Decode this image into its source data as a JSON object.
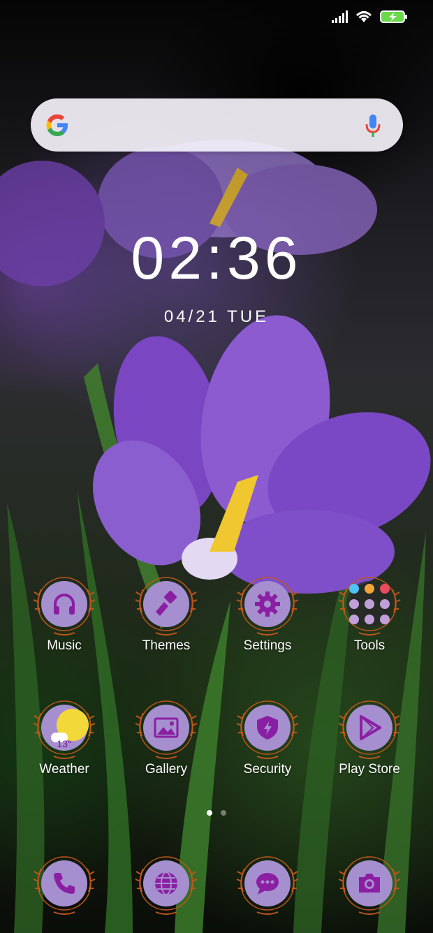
{
  "clock": {
    "time": "02:36",
    "date": "04/21 TUE"
  },
  "search": {
    "placeholder": ""
  },
  "apps": {
    "row1": [
      {
        "label": "Music",
        "icon": "headphones-icon"
      },
      {
        "label": "Themes",
        "icon": "paintbrush-icon"
      },
      {
        "label": "Settings",
        "icon": "gear-icon"
      },
      {
        "label": "Tools",
        "icon": "folder-icon"
      }
    ],
    "row2": [
      {
        "label": "Weather",
        "icon": "weather-icon",
        "temp": "13°"
      },
      {
        "label": "Gallery",
        "icon": "image-icon"
      },
      {
        "label": "Security",
        "icon": "shield-icon"
      },
      {
        "label": "Play Store",
        "icon": "play-icon"
      }
    ]
  },
  "dock": [
    {
      "icon": "phone-icon"
    },
    {
      "icon": "globe-icon"
    },
    {
      "icon": "chat-icon"
    },
    {
      "icon": "camera-icon"
    }
  ],
  "pager": {
    "pages": 2,
    "current": 1
  },
  "colors": {
    "accent": "#8b1fa3",
    "disc": "#a68fcf",
    "wreath": "#c0561c"
  }
}
